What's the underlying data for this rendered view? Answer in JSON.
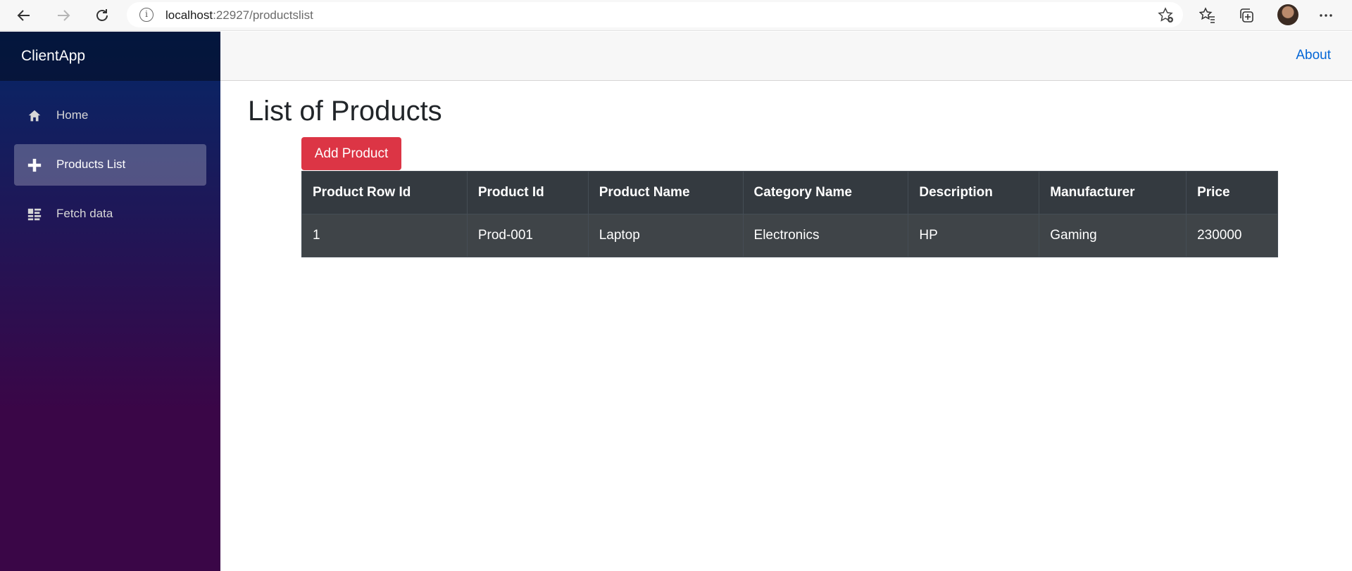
{
  "browser": {
    "url_host": "localhost",
    "url_rest": ":22927/productslist",
    "info_glyph": "i",
    "icons": [
      "back-icon",
      "forward-icon",
      "refresh-icon",
      "site-info-icon",
      "add-favorite-icon",
      "favorites-icon",
      "collections-icon",
      "profile-avatar",
      "more-icon"
    ]
  },
  "app": {
    "brand": "ClientApp",
    "about": "About",
    "sidebar": {
      "items": [
        {
          "label": "Home",
          "icon": "home-icon",
          "active": false
        },
        {
          "label": "Products List",
          "icon": "plus-icon",
          "active": true
        },
        {
          "label": "Fetch data",
          "icon": "list-icon",
          "active": false
        }
      ]
    }
  },
  "main": {
    "title": "List of Products",
    "add_button": "Add Product",
    "table": {
      "headers": [
        "Product Row Id",
        "Product Id",
        "Product Name",
        "Category Name",
        "Description",
        "Manufacturer",
        "Price"
      ],
      "rows": [
        [
          "1",
          "Prod-001",
          "Laptop",
          "Electronics",
          "HP",
          "Gaming",
          "230000"
        ]
      ]
    }
  },
  "colors": {
    "sidebar_top": "#052767",
    "sidebar_bottom": "#3a0647",
    "add_button": "#dc3545",
    "table_dark": "#343a40",
    "link": "#0366d6"
  }
}
